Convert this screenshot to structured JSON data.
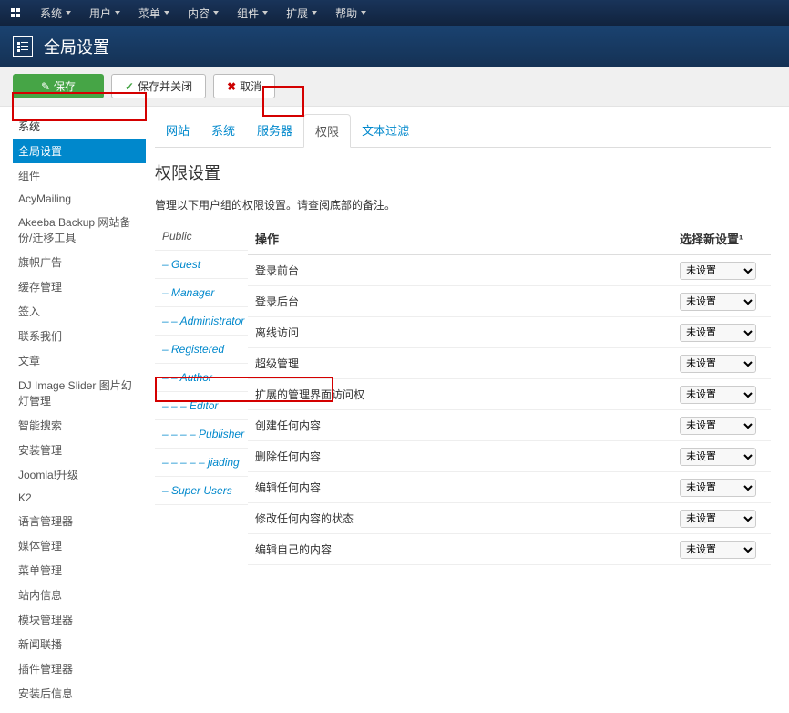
{
  "topmenu": [
    "系统",
    "用户",
    "菜单",
    "内容",
    "组件",
    "扩展",
    "帮助"
  ],
  "page_title": "全局设置",
  "toolbar": {
    "save": "保存",
    "save_close": "保存并关闭",
    "cancel": "取消"
  },
  "sidebar": [
    "系统",
    "全局设置",
    "组件",
    "AcyMailing",
    "Akeeba Backup 网站备份/迁移工具",
    "旗帜广告",
    "缓存管理",
    "签入",
    "联系我们",
    "文章",
    "DJ Image Slider 图片幻灯管理",
    "智能搜索",
    "安装管理",
    "Joomla!升级",
    "K2",
    "语言管理器",
    "媒体管理",
    "菜单管理",
    "站内信息",
    "模块管理器",
    "新闻联播",
    "插件管理器",
    "安装后信息"
  ],
  "tabs": [
    "网站",
    "系统",
    "服务器",
    "权限",
    "文本过滤"
  ],
  "section_title": "权限设置",
  "desc": "管理以下用户组的权限设置。请查阅底部的备注。",
  "groups": [
    {
      "label": "Public",
      "depth": 0
    },
    {
      "label": "Guest",
      "depth": 1
    },
    {
      "label": "Manager",
      "depth": 1
    },
    {
      "label": "Administrator",
      "depth": 2
    },
    {
      "label": "Registered",
      "depth": 1
    },
    {
      "label": "Author",
      "depth": 2
    },
    {
      "label": "Editor",
      "depth": 3
    },
    {
      "label": "Publisher",
      "depth": 4
    },
    {
      "label": "jiading",
      "depth": 5
    },
    {
      "label": "Super Users",
      "depth": 1
    }
  ],
  "perm_header": {
    "action": "操作",
    "select": "选择新设置¹"
  },
  "actions": [
    "登录前台",
    "登录后台",
    "离线访问",
    "超级管理",
    "扩展的管理界面访问权",
    "创建任何内容",
    "删除任何内容",
    "编辑任何内容",
    "修改任何内容的状态",
    "编辑自己的内容"
  ],
  "select_default": "未设置"
}
